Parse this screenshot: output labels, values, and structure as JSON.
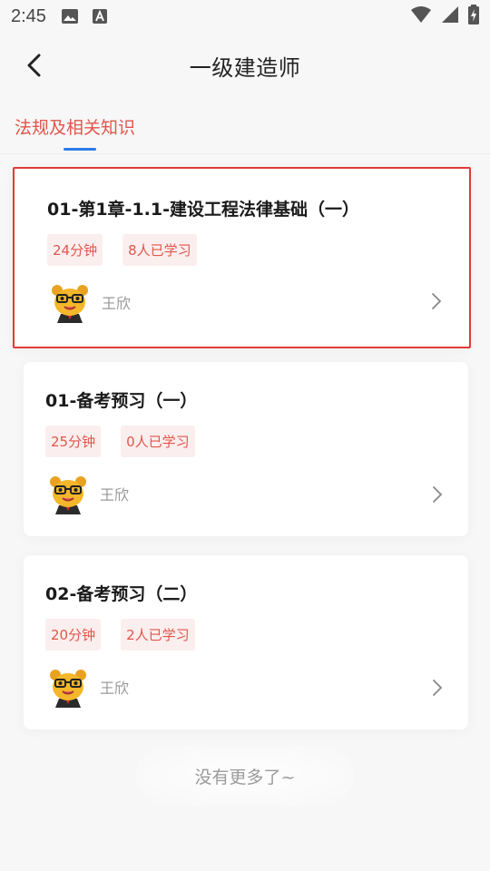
{
  "status_bar": {
    "time": "2:45",
    "icons": [
      "image-icon",
      "font-icon",
      "wifi-icon",
      "signal-icon",
      "battery-charging-icon"
    ]
  },
  "nav": {
    "title": "一级建造师",
    "back_icon": "chevron-left-icon"
  },
  "tabs": [
    {
      "label": "法规及相关知识",
      "active": true
    }
  ],
  "courses": [
    {
      "title": "01-第1章-1.1-建设工程法律基础（一）",
      "duration": "24分钟",
      "learners": "8人已学习",
      "teacher": "王欣",
      "selected": true
    },
    {
      "title": "01-备考预习（一）",
      "duration": "25分钟",
      "learners": "0人已学习",
      "teacher": "王欣",
      "selected": false
    },
    {
      "title": "02-备考预习（二）",
      "duration": "20分钟",
      "learners": "2人已学习",
      "teacher": "王欣",
      "selected": false
    }
  ],
  "footer": {
    "no_more": "没有更多了~"
  },
  "colors": {
    "accent_red": "#e2554a",
    "tab_indicator_blue": "#2d7be5",
    "tag_bg": "#fbeeee",
    "selection_border": "#e03a3a"
  }
}
